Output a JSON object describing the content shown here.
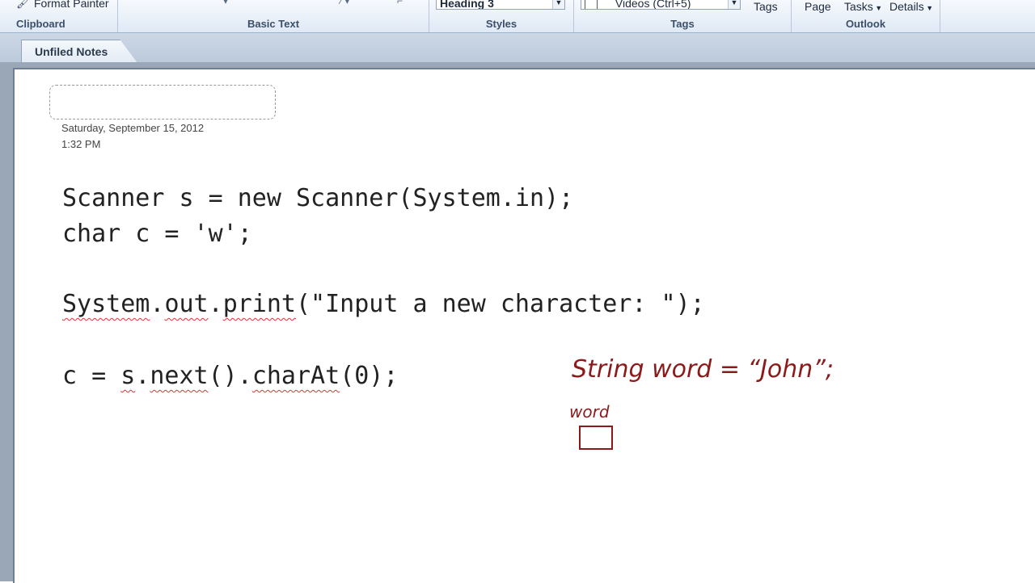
{
  "ribbon": {
    "clipboard": {
      "label": "Clipboard",
      "format_painter": "Format Painter"
    },
    "basic_text": {
      "label": "Basic Text"
    },
    "styles": {
      "label": "Styles",
      "style_value": "Heading 3"
    },
    "tags": {
      "label": "Tags",
      "tag_value": "Videos (Ctrl+5)",
      "tags_button": "Tags"
    },
    "outlook": {
      "label": "Outlook",
      "page": "Page",
      "tasks": "Tasks",
      "details": "Details"
    }
  },
  "tab": {
    "label": "Unfiled Notes"
  },
  "note": {
    "date": "Saturday, September  15, 2012",
    "time": "1:32 PM",
    "code": {
      "line1": "Scanner s = new Scanner(System.in);",
      "line2": "char c = 'w';",
      "line3_a": "System",
      "line3_b": ".",
      "line3_c": "out",
      "line3_d": ".",
      "line3_e": "print",
      "line3_f": "(\"Input a new character: \");",
      "line4_a": "c = ",
      "line4_b": "s",
      "line4_c": ".",
      "line4_d": "next",
      "line4_e": "().",
      "line4_f": "charAt",
      "line4_g": "(0);"
    },
    "ink": {
      "statement": "String word = “John”;",
      "var_label": "word"
    }
  },
  "colors": {
    "ink": "#8b1a1a",
    "squiggle": "#dd3333"
  }
}
